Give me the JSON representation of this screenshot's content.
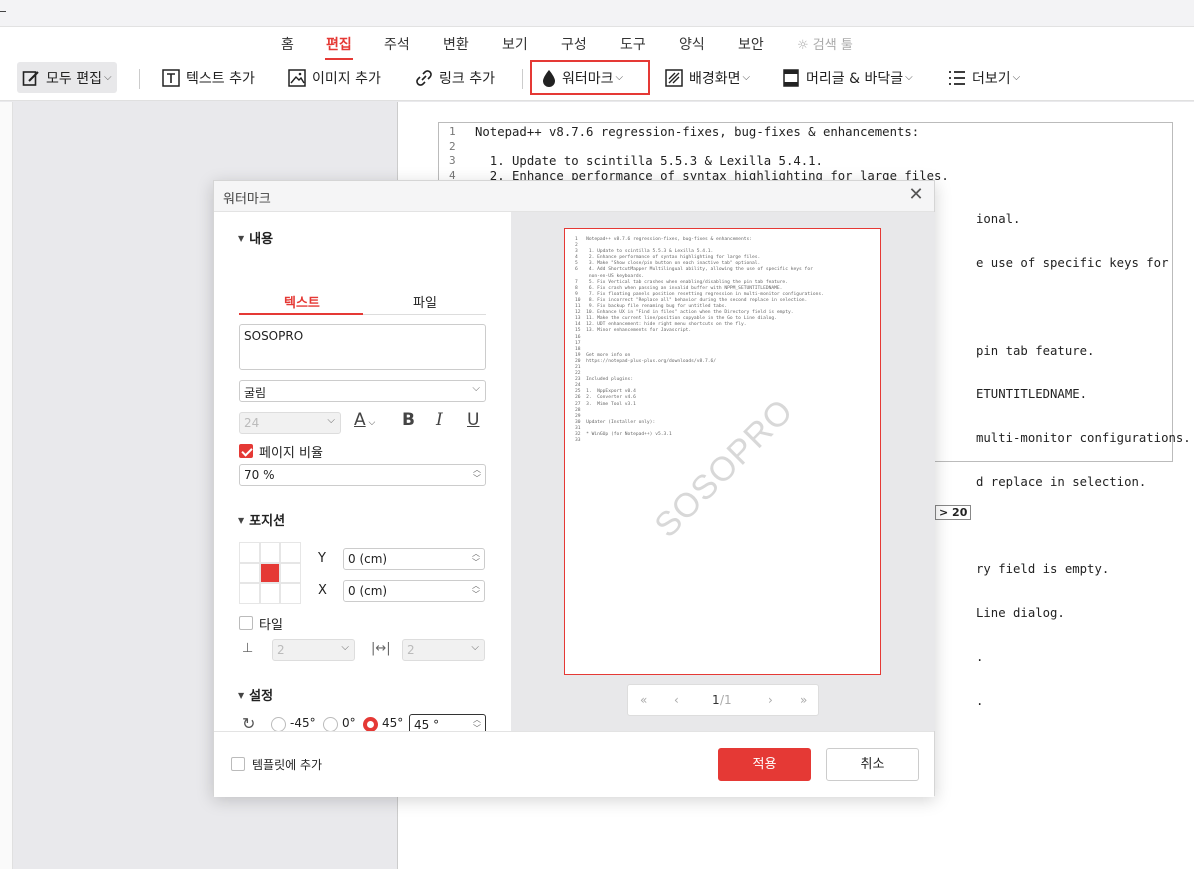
{
  "ribbon": {
    "menu_tabs": [
      "홈",
      "편집",
      "주석",
      "변환",
      "보기",
      "구성",
      "도구",
      "양식",
      "보안"
    ],
    "search_label": "검색 툴",
    "tools": {
      "edit_all": "모두 편집",
      "add_text": "텍스트 추가",
      "add_image": "이미지 추가",
      "add_link": "링크 추가",
      "watermark": "워터마크",
      "background": "배경화면",
      "header_footer": "머리글 & 바닥글",
      "more": "더보기"
    }
  },
  "document": {
    "lines": [
      {
        "n": "1",
        "t": "Notepad++ v8.7.6 regression-fixes, bug-fixes & enhancements:"
      },
      {
        "n": "2",
        "t": ""
      },
      {
        "n": "3",
        "t": "  1. Update to scintilla 5.5.3 & Lexilla 5.4.1."
      },
      {
        "n": "4",
        "t": "  2. Enhance performance of syntax highlighting for large files."
      }
    ],
    "visible_right": [
      "ional.",
      "e use of specific keys for",
      "",
      "pin tab feature.",
      "ETUNTITLEDNAME.",
      "multi-monitor configurations.",
      "d replace in selection.",
      "",
      "ry field is empty.",
      "Line dialog.",
      ".",
      "."
    ],
    "snippet": "> 20"
  },
  "dialog": {
    "title": "워터마크",
    "content_section": "내용",
    "tab_text": "텍스트",
    "tab_file": "파일",
    "text_value": "SOSOPRO",
    "font": "굴림",
    "font_size": "24",
    "page_ratio_label": "페이지 비율",
    "page_ratio_value": "70 %",
    "position_section": "포지션",
    "y_label": "Y",
    "y_value": "0 (cm)",
    "x_label": "X",
    "x_value": "0 (cm)",
    "tile_label": "타일",
    "tile_v": "2",
    "tile_h": "2",
    "settings_section": "설정",
    "rot_neg45": "-45°",
    "rot_0": "0°",
    "rot_45": "45°",
    "rotation_value": "45 °",
    "template_label": "템플릿에 추가",
    "apply": "적용",
    "cancel": "취소",
    "pager": {
      "first": "«",
      "prev": "‹",
      "page": "1",
      "total": "/1",
      "next": "›",
      "last": "»"
    }
  },
  "preview": {
    "watermark": "SOSOPRO",
    "lines": [
      "1   Notepad++ v8.7.6 regression-fixes, bug-fixes & enhancements:",
      "2",
      "3    1. Update to scintilla 5.5.3 & Lexilla 5.4.1.",
      "4    2. Enhance performance of syntax highlighting for large files.",
      "5    3. Make \"Show close/pin button on each inactive tab\" optional.",
      "6    4. Add ShortcutMapper Multilingual ability, allowing the use of specific keys for",
      "     non-en-US keyboards.",
      "7    5. Fix Vertical tab crashes when enabling/disabling the pin tab feature.",
      "8    6. Fix crash when passing an invalid buffer with NPPM_SETUNTITLEDNAME.",
      "9    7. Fix floating panels position resetting regression in multi-monitor configurations.",
      "10   8. Fix incorrect \"Replace all\" behavior during the second replace in selection.",
      "11   9. Fix backup file renaming bug for untitled tabs.",
      "12  10. Enhance UX in \"Find in files\" action when the Directory field is empty.",
      "13  11. Make the current line/position copyable in the Go to Line dialog.",
      "14  12. UDT enhancement: hide right menu shortcuts on the fly.",
      "15  13. Minor enhancements for Javascript.",
      "16",
      "17",
      "18",
      "19  Get more info on",
      "20  https://notepad-plus-plus.org/downloads/v8.7.6/",
      "21",
      "22",
      "23  Included plugins:",
      "24",
      "25  1.  NppExport v0.4",
      "26  2.  Converter v4.6",
      "27  3.  Mime Tool v3.1",
      "28",
      "29",
      "30  Updater (Installer only):",
      "31",
      "32  * WinGUp (for Notepad++) v5.3.1",
      "33"
    ]
  }
}
